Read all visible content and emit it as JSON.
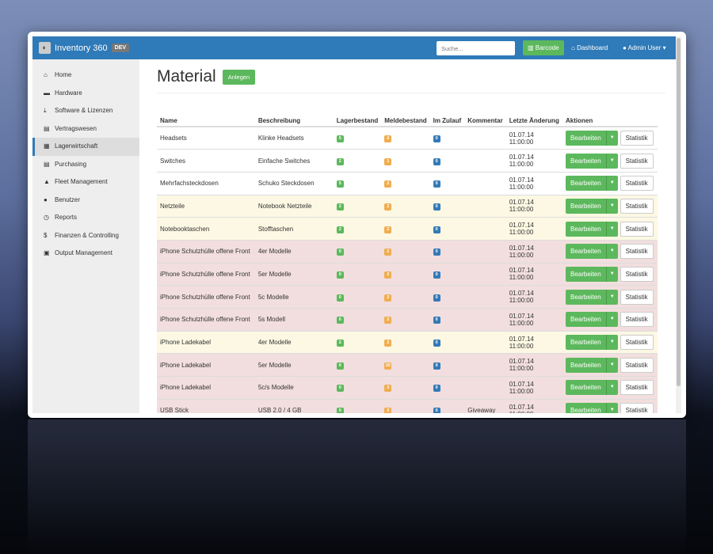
{
  "app": {
    "title": "Inventory 360",
    "env_badge": "DEV"
  },
  "navbar": {
    "search_placeholder": "Suche...",
    "barcode": "Barcode",
    "dashboard": "Dashboard",
    "user": "Admin User"
  },
  "sidebar": {
    "items": [
      {
        "label": "Home",
        "icon": "⌂"
      },
      {
        "label": "Hardware",
        "icon": "▬"
      },
      {
        "label": "Software & Lizenzen",
        "icon": "⤓"
      },
      {
        "label": "Vertragswesen",
        "icon": "▤"
      },
      {
        "label": "Lagerwirtschaft",
        "icon": "▦"
      },
      {
        "label": "Purchasing",
        "icon": "▤"
      },
      {
        "label": "Fleet Management",
        "icon": "▲"
      },
      {
        "label": "Benutzer",
        "icon": "●"
      },
      {
        "label": "Reports",
        "icon": "◷"
      },
      {
        "label": "Finanzen & Controlling",
        "icon": "$"
      },
      {
        "label": "Output Management",
        "icon": "▣"
      }
    ],
    "active": "Lagerwirtschaft"
  },
  "page": {
    "title": "Material",
    "create_button": "Anlegen"
  },
  "table": {
    "headers": [
      "Name",
      "Beschreibung",
      "Lagerbestand",
      "Meldebestand",
      "Im Zulauf",
      "Kommentar",
      "Letzte Änderung",
      "Aktionen"
    ],
    "edit_label": "Bearbeiten",
    "stats_label": "Statistik",
    "rows": [
      {
        "name": "Headsets",
        "desc": "Klinke Headsets",
        "stock": "5",
        "min": "2",
        "incoming": "0",
        "comment": "",
        "changed": "01.07.14 11:00:00",
        "status": "ok"
      },
      {
        "name": "Switches",
        "desc": "Einfache Switches",
        "stock": "2",
        "min": "1",
        "incoming": "0",
        "comment": "",
        "changed": "01.07.14 11:00:00",
        "status": "ok"
      },
      {
        "name": "Mehrfachsteckdosen",
        "desc": "Schuko Steckdosen",
        "stock": "5",
        "min": "2",
        "incoming": "0",
        "comment": "",
        "changed": "01.07.14 11:00:00",
        "status": "ok"
      },
      {
        "name": "Netzteile",
        "desc": "Notebook Netzteile",
        "stock": "2",
        "min": "2",
        "incoming": "0",
        "comment": "",
        "changed": "01.07.14 11:00:00",
        "status": "warning"
      },
      {
        "name": "Notebooktaschen",
        "desc": "Stofftaschen",
        "stock": "2",
        "min": "2",
        "incoming": "0",
        "comment": "",
        "changed": "01.07.14 11:00:00",
        "status": "warning"
      },
      {
        "name": "iPhone Schutzhülle offene Front",
        "desc": "4er Modelle",
        "stock": "0",
        "min": "2",
        "incoming": "0",
        "comment": "",
        "changed": "01.07.14 11:00:00",
        "status": "danger"
      },
      {
        "name": "iPhone Schutzhülle offene Front",
        "desc": "5er Modelle",
        "stock": "0",
        "min": "2",
        "incoming": "0",
        "comment": "",
        "changed": "01.07.14 11:00:00",
        "status": "danger"
      },
      {
        "name": "iPhone Schutzhülle offene Front",
        "desc": "5c Modelle",
        "stock": "0",
        "min": "2",
        "incoming": "0",
        "comment": "",
        "changed": "01.07.14 11:00:00",
        "status": "danger"
      },
      {
        "name": "iPhone Schutzhülle offene Front",
        "desc": "5s Modell",
        "stock": "0",
        "min": "2",
        "incoming": "0",
        "comment": "",
        "changed": "01.07.14 11:00:00",
        "status": "danger"
      },
      {
        "name": "iPhone Ladekabel",
        "desc": "4er Modelle",
        "stock": "2",
        "min": "2",
        "incoming": "0",
        "comment": "",
        "changed": "01.07.14 11:00:00",
        "status": "warning"
      },
      {
        "name": "iPhone Ladekabel",
        "desc": "5er Modelle",
        "stock": "0",
        "min": "20",
        "incoming": "0",
        "comment": "",
        "changed": "01.07.14 11:00:00",
        "status": "danger"
      },
      {
        "name": "iPhone Ladekabel",
        "desc": "5c/s Modelle",
        "stock": "0",
        "min": "3",
        "incoming": "0",
        "comment": "",
        "changed": "01.07.14 11:00:00",
        "status": "danger"
      },
      {
        "name": "USB Stick",
        "desc": "USB 2.0 / 4 GB",
        "stock": "0",
        "min": "2",
        "incoming": "0",
        "comment": "Giveaway",
        "changed": "01.07.14 11:00:00",
        "status": "danger"
      }
    ]
  }
}
